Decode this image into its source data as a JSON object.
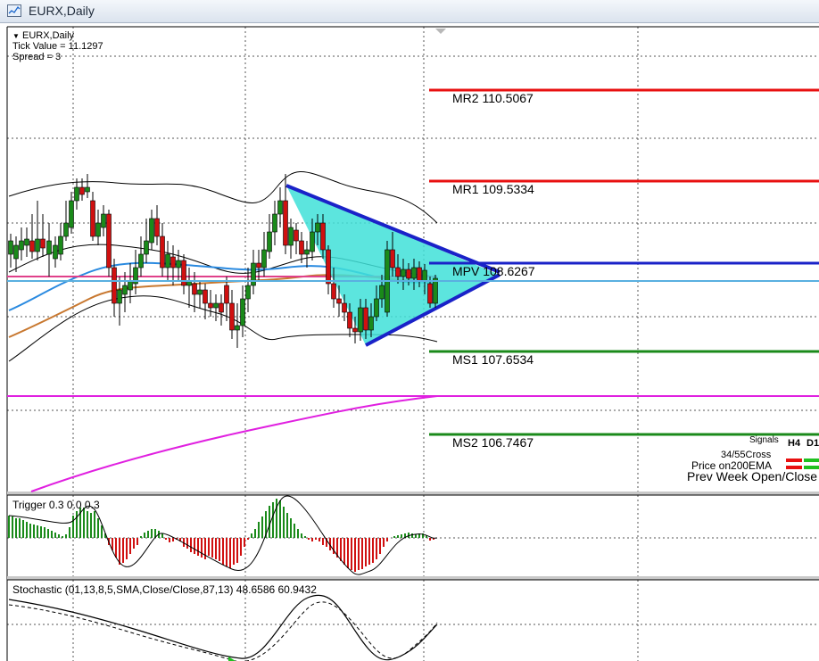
{
  "window": {
    "title": "EURX,Daily"
  },
  "chart_info": {
    "symbol": "EURX,Daily",
    "tick_value": "Tick Value = 11.1297",
    "spread": "Spread = 3"
  },
  "pivots": [
    {
      "label": "MR2",
      "value": "110.5067",
      "color": "#e81010"
    },
    {
      "label": "MR1",
      "value": "109.5334",
      "color": "#e81010"
    },
    {
      "label": "MPV",
      "value": "108.6267",
      "color": "#1a22c8"
    },
    {
      "label": "MS1",
      "value": "107.6534",
      "color": "#1a8a1a"
    },
    {
      "label": "MS2",
      "value": "106.7467",
      "color": "#1a8a1a"
    }
  ],
  "signals": {
    "header": "Signals",
    "timeframes": [
      "H4",
      "D1"
    ],
    "rows": [
      "34/55Cross",
      "Price on200EMA",
      "Prev Week Open/Close"
    ]
  },
  "indicators": {
    "trigger_label": "Trigger 0.3 0.0 0.3",
    "stochastic_label": "Stochastic (01,13,8,5,SMA,Close/Close,87,13) 48.6586 60.9432"
  },
  "colors": {
    "bull": "#1a8a1a",
    "bear": "#d01010",
    "triangle_fill": "#40e0d8",
    "triangle_edge": "#1a22c8",
    "ema200": "#e020e0",
    "ma_blue": "#2a8ae0",
    "ma_orange": "#c87830"
  }
}
